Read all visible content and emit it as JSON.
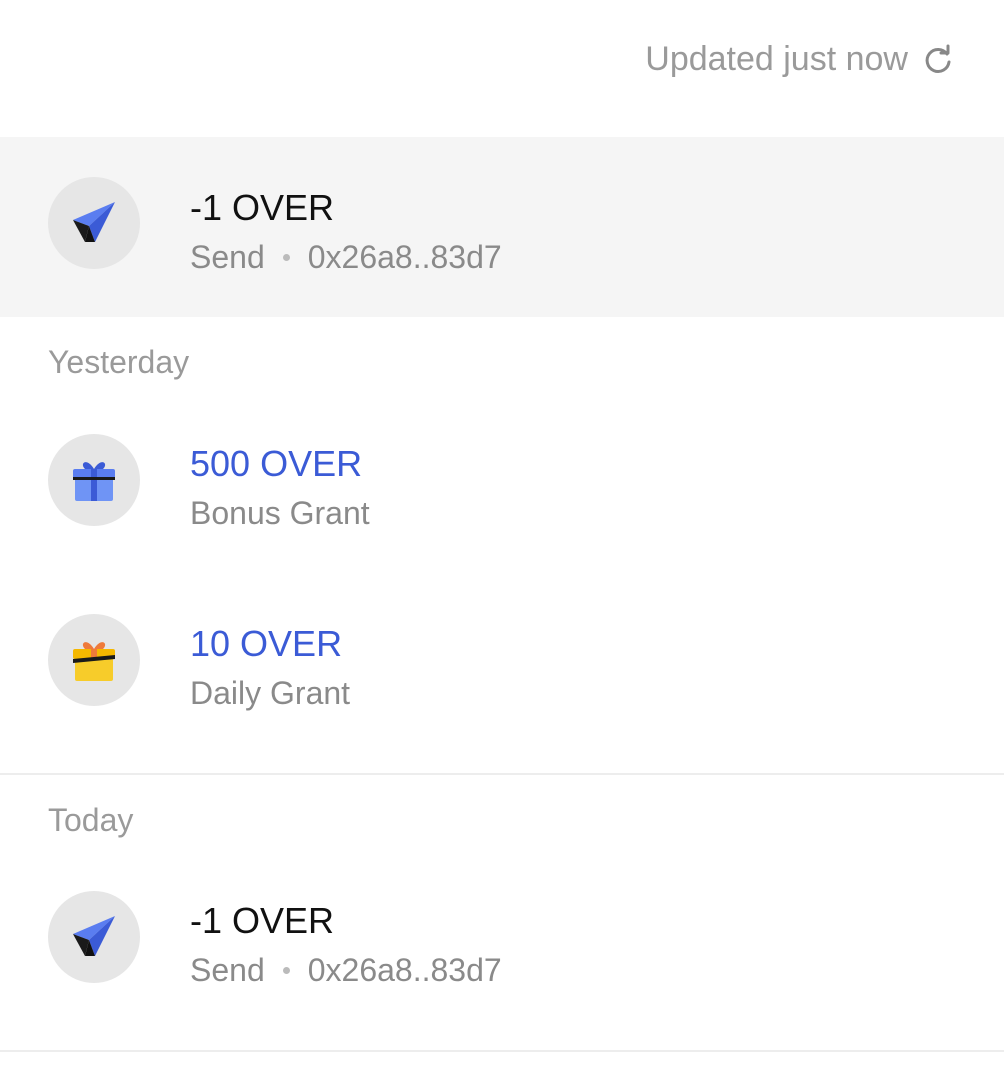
{
  "header": {
    "updated_text": "Updated just now",
    "refresh_icon": "refresh-icon"
  },
  "colors": {
    "accent": "#3b5bd6",
    "muted": "#9a9a9a",
    "highlight_row": "#f5f5f5",
    "icon_bg": "#e6e6e6"
  },
  "transactions_top": [
    {
      "amount": "-1 OVER",
      "type": "Send",
      "address": "0x26a8..83d7",
      "icon": "paper-plane-icon"
    }
  ],
  "sections": [
    {
      "label": "Yesterday",
      "items": [
        {
          "amount": "500 OVER",
          "type": "Bonus Grant",
          "icon": "gift-blue-icon"
        },
        {
          "amount": "10 OVER",
          "type": "Daily Grant",
          "icon": "gift-yellow-icon"
        }
      ]
    },
    {
      "label": "Today",
      "items": [
        {
          "amount": "-1 OVER",
          "type": "Send",
          "address": "0x26a8..83d7",
          "icon": "paper-plane-icon"
        }
      ]
    }
  ]
}
